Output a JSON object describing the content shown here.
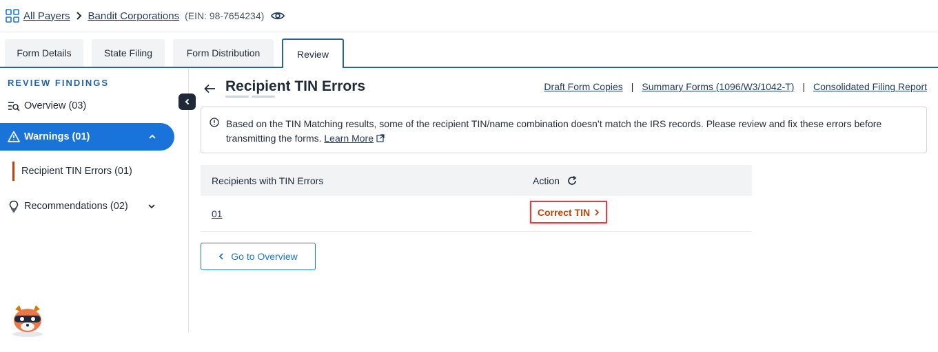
{
  "breadcrumb": {
    "all_payers": "All Payers",
    "company": "Bandit Corporations",
    "ein": "(EIN: 98-7654234)"
  },
  "tabs": [
    {
      "label": "Form Details"
    },
    {
      "label": "State Filing"
    },
    {
      "label": "Form Distribution"
    },
    {
      "label": "Review",
      "active": true
    }
  ],
  "sidebar": {
    "heading": "REVIEW FINDINGS",
    "overview": "Overview (03)",
    "warnings": "Warnings (01)",
    "recipient_tin_errors": "Recipient TIN Errors (01)",
    "recommendations": "Recommendations (02)"
  },
  "main": {
    "title": "Recipient TIN Errors",
    "links": {
      "draft": "Draft Form Copies",
      "summary": "Summary Forms (1096/W3/1042-T)",
      "consolidated": "Consolidated Filing Report"
    },
    "info_text": "Based on the TIN Matching results, some of the recipient TIN/name combination doesn’t match the IRS records. Please review and fix these errors before transmitting the forms.",
    "learn_more": "Learn More",
    "table": {
      "headers": [
        "Recipients with TIN Errors",
        "Action"
      ],
      "rows": [
        {
          "id": "01",
          "action": "Correct TIN"
        }
      ]
    },
    "go_to_overview": "Go to Overview"
  },
  "colors": {
    "primary": "#1a73d9",
    "accent_orange": "#c2410c",
    "highlight_red": "#e53e3e",
    "link_navy": "#1f3a5f"
  },
  "icons": [
    "grid-icon",
    "chevron-right-icon",
    "eye-icon",
    "overview-search-icon",
    "warning-icon",
    "chevron-up-icon",
    "lightbulb-icon",
    "chevron-down-icon",
    "collapse-left-icon",
    "back-arrow-icon",
    "info-icon",
    "external-link-icon",
    "refresh-icon",
    "chevron-left-icon",
    "mascot-raccoon"
  ]
}
